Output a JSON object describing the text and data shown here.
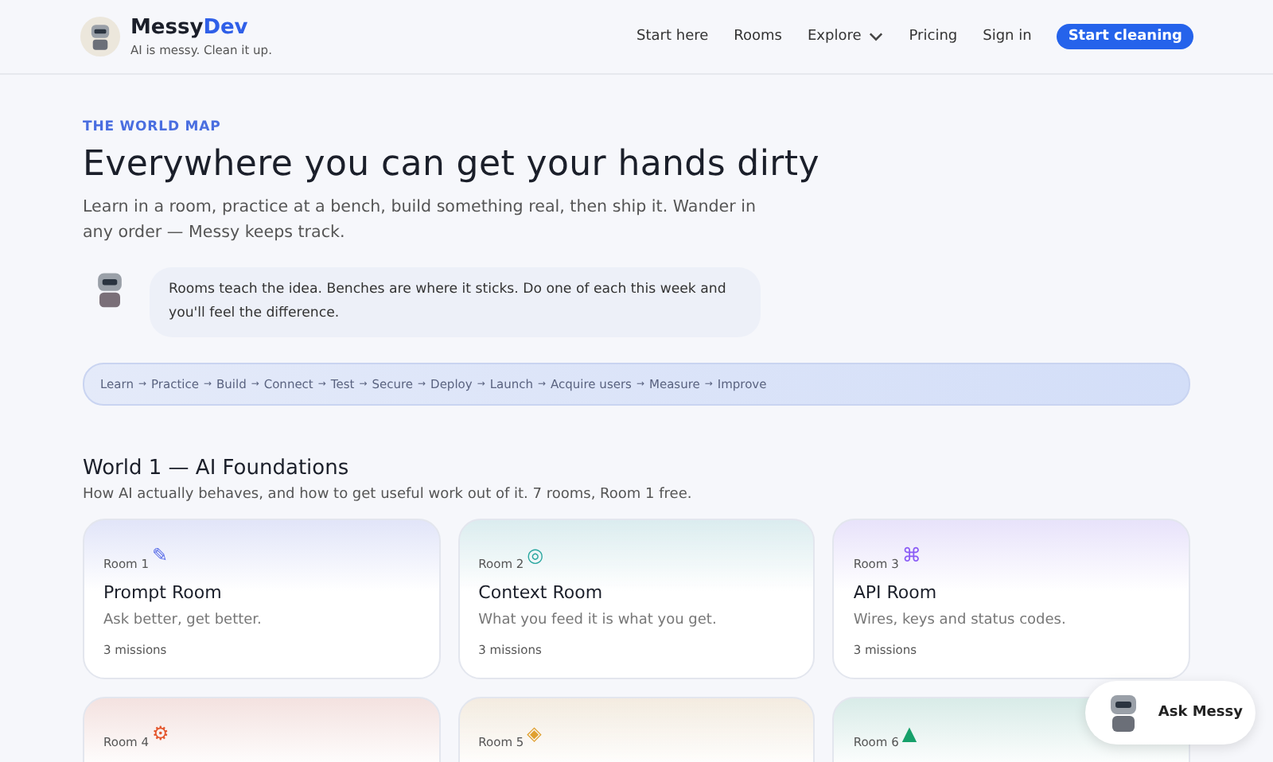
{
  "header": {
    "brand": {
      "name_first": "Messy",
      "name_second": "Dev",
      "tagline": "AI is messy. Clean it up."
    },
    "nav": [
      {
        "label": "Start here",
        "kind": "link"
      },
      {
        "label": "Rooms",
        "kind": "link"
      },
      {
        "label": "Explore",
        "kind": "dropdown"
      },
      {
        "label": "Pricing",
        "kind": "link"
      },
      {
        "label": "Sign in",
        "kind": "link"
      },
      {
        "label": "Start cleaning",
        "kind": "primary"
      }
    ]
  },
  "hero": {
    "eyebrow": "THE WORLD MAP",
    "title": "Everywhere you can get your hands dirty",
    "lead": "Learn in a room, practice at a bench, build something real, then ship it. Wander in any order — Messy keeps track.",
    "tip": "Rooms teach the idea. Benches are where it sticks. Do one of each this week and you'll feel the difference."
  },
  "path": {
    "separator": "→",
    "steps": [
      "Learn",
      "Practice",
      "Build",
      "Connect",
      "Test",
      "Secure",
      "Deploy",
      "Launch",
      "Acquire users",
      "Measure",
      "Improve"
    ]
  },
  "world": {
    "title": "World 1 — AI Foundations",
    "subtitle": "How AI actually behaves, and how to get useful work out of it. 7 rooms, Room 1 free.",
    "rooms": [
      {
        "number": "Room 1",
        "icon": "✎",
        "color": "#5b6ee8",
        "name": "Prompt Room",
        "description": "Ask better, get better.",
        "missions": "3 missions"
      },
      {
        "number": "Room 2",
        "icon": "◎",
        "color": "#2aa7a0",
        "name": "Context Room",
        "description": "What you feed it is what you get.",
        "missions": "3 missions"
      },
      {
        "number": "Room 3",
        "icon": "⌘",
        "color": "#8b5cf6",
        "name": "API Room",
        "description": "Wires, keys and status codes.",
        "missions": "3 missions"
      },
      {
        "number": "Room 4",
        "icon": "⚙",
        "color": "#e4572e"
      },
      {
        "number": "Room 5",
        "icon": "◈",
        "color": "#e0a030"
      },
      {
        "number": "Room 6",
        "icon": "▲",
        "color": "#16a06a"
      }
    ]
  },
  "assistant": {
    "label": "Ask Messy"
  }
}
